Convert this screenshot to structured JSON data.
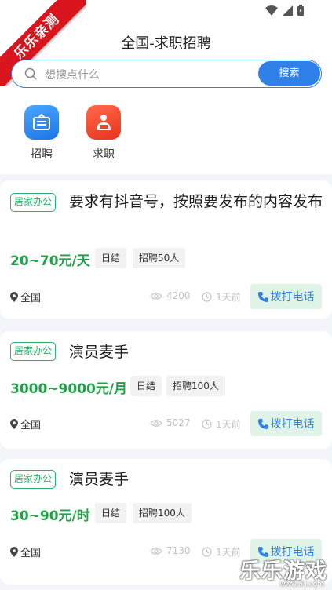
{
  "watermark": {
    "corner_badge": "乐乐亲测",
    "logo_text": "乐乐游戏",
    "logo_url": "www.6ll.com"
  },
  "header": {
    "title": "全国-求职招聘"
  },
  "search": {
    "placeholder": "想搜点什么",
    "button_label": "搜索"
  },
  "shortcuts": [
    {
      "label": "招聘",
      "icon": "recruit-board-icon",
      "color": "#2a86f0"
    },
    {
      "label": "求职",
      "icon": "job-seeker-icon",
      "color": "#f0442a"
    }
  ],
  "jobs": [
    {
      "tag": "居家办公",
      "title": "要求有抖音号，按照要发布的内容发布",
      "salary": "20~70元/天",
      "chips": [
        "日结",
        "招聘50人"
      ],
      "location": "全国",
      "views": "4200",
      "time": "1天前",
      "call_label": "拨打电话"
    },
    {
      "tag": "居家办公",
      "title": "演员麦手",
      "salary": "3000~9000元/月",
      "chips": [
        "日结",
        "招聘100人"
      ],
      "location": "全国",
      "views": "5027",
      "time": "1天前",
      "call_label": "拨打电话"
    },
    {
      "tag": "居家办公",
      "title": "演员麦手",
      "salary": "30~90元/时",
      "chips": [
        "日结",
        "招聘100人"
      ],
      "location": "全国",
      "views": "7130",
      "time": "1天前",
      "call_label": "拨打电话"
    }
  ],
  "colors": {
    "accent": "#2f80e9",
    "salary": "#25a04a",
    "tag": "#2ab36b",
    "call_bg": "#dff3e6"
  }
}
